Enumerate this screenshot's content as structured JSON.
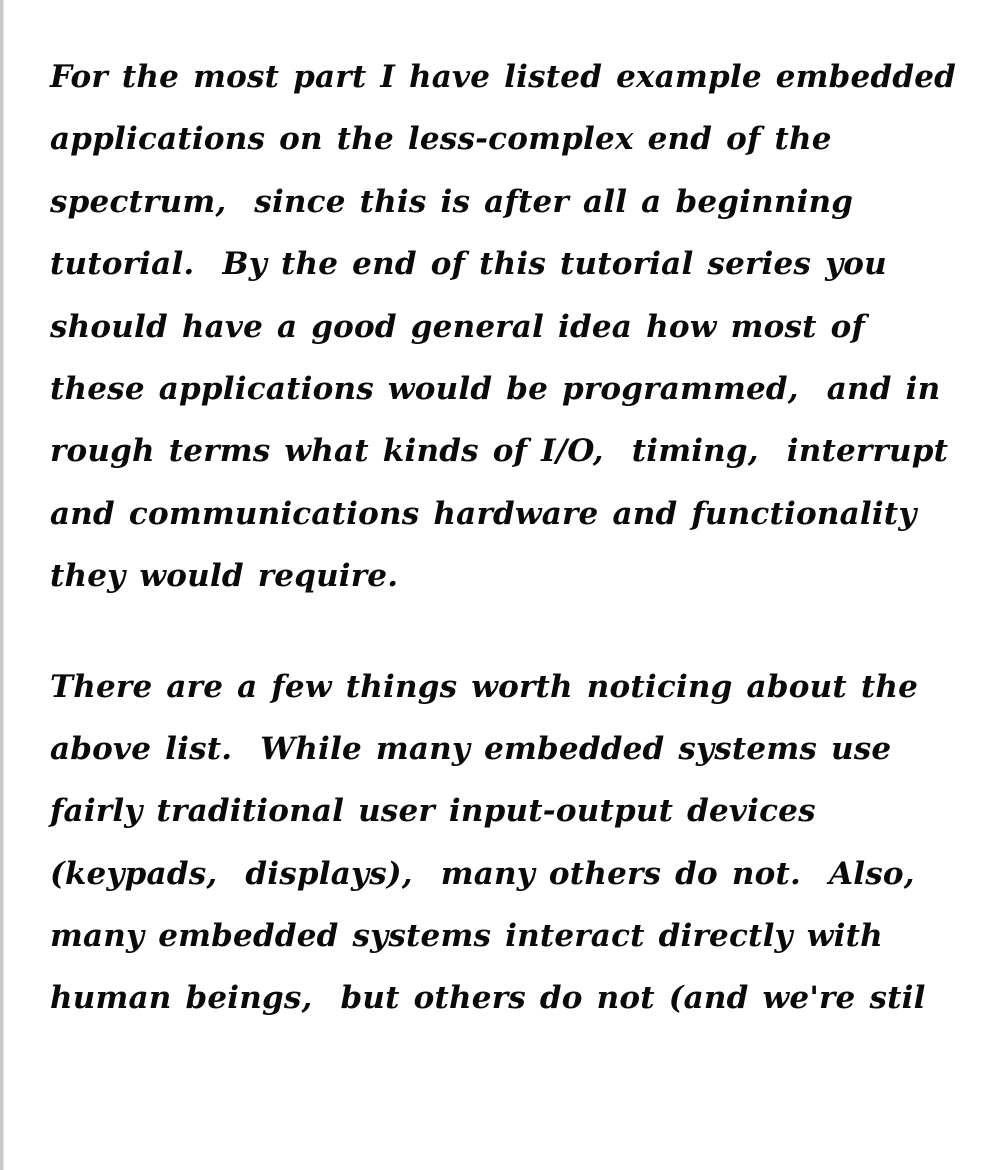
{
  "document": {
    "paragraphs": [
      {
        "lines": [
          "For the most part I have listed example embedded",
          "applications on the less-complex end of the",
          "spectrum,  since this is after all a beginning",
          "tutorial.  By the end of this tutorial series you",
          "should have a good general idea how most of",
          "these applications would be programmed,  and in",
          "rough terms what kinds of I/O,  timing,  interrupt",
          "and communications hardware and functionality",
          "they would require."
        ]
      },
      {
        "lines": [
          "There are a few things worth noticing about the",
          "above list.  While many embedded systems use",
          "fairly traditional user input-output devices",
          "(keypads,  displays),  many others do not.  Also,",
          "many embedded systems interact directly with",
          "human beings,  but others do not (and we're stil"
        ]
      }
    ]
  }
}
